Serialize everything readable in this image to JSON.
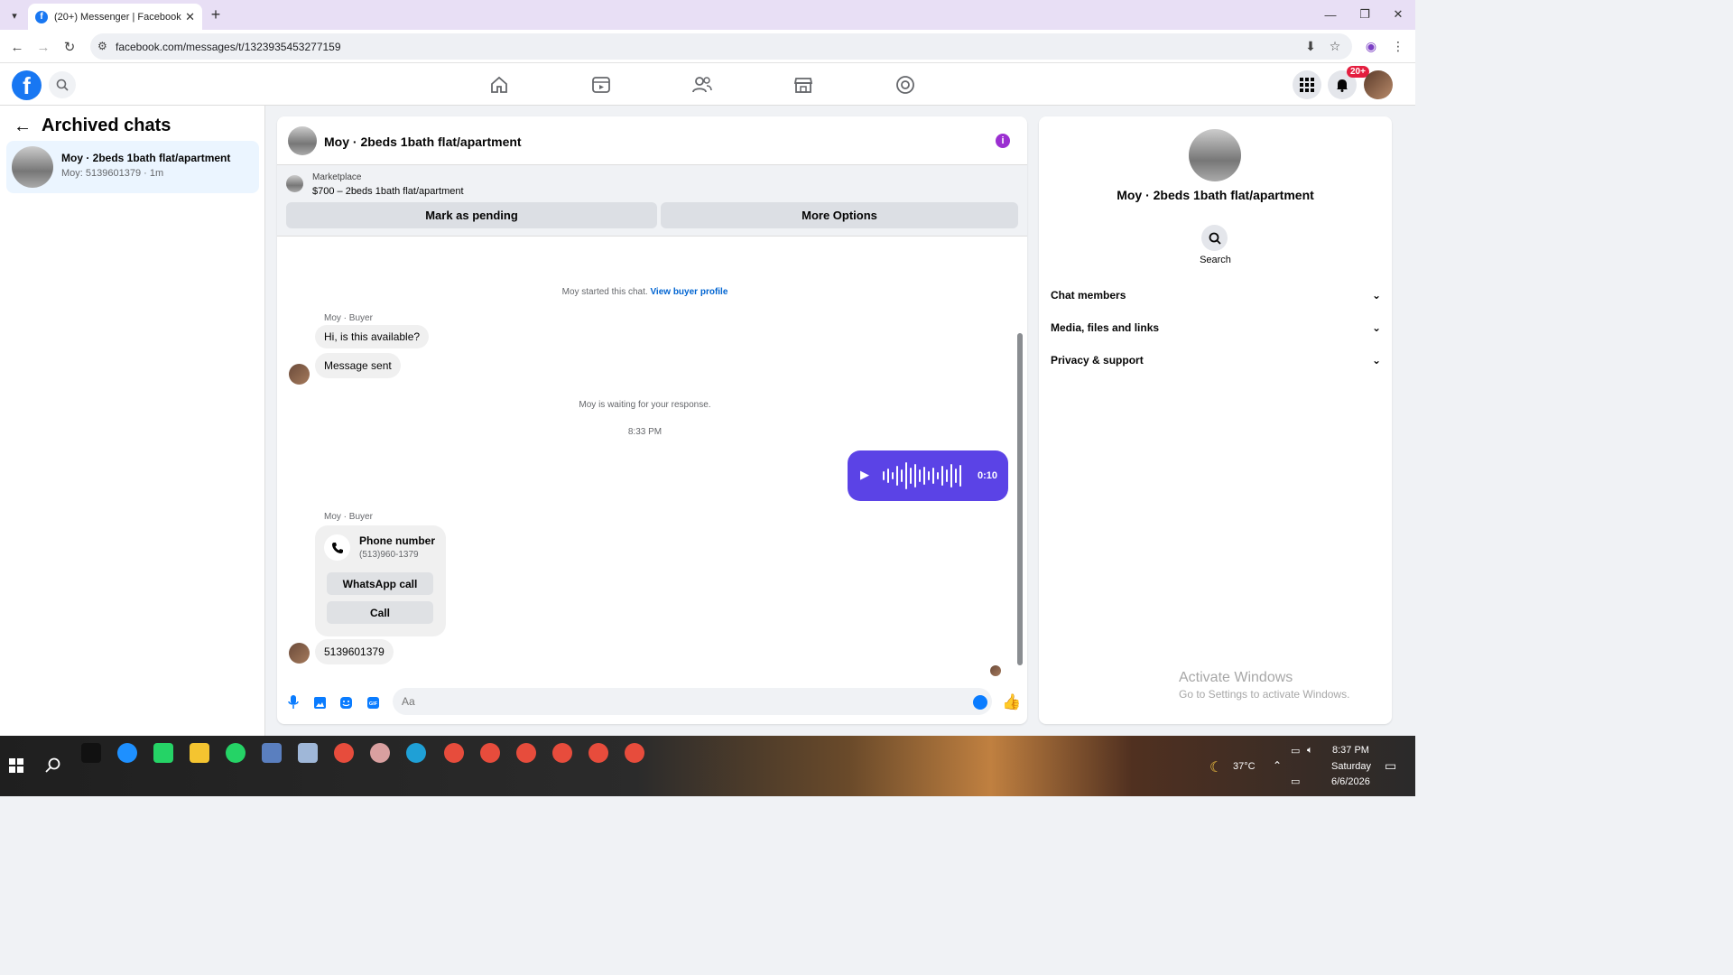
{
  "browser": {
    "tab_title": "(20+) Messenger | Facebook",
    "tab_close": "✕",
    "new_tab": "+",
    "url": "facebook.com/messages/t/1323935453277159",
    "win_min": "—",
    "win_restore": "❐",
    "win_close": "✕"
  },
  "fb_header": {
    "logo": "f",
    "notification_badge": "20+"
  },
  "left_pane": {
    "title": "Archived chats",
    "back_arrow": "←",
    "chats": [
      {
        "name": "Moy · 2beds 1bath flat/apartment",
        "subtitle": "Moy: 5139601379 · 1m"
      }
    ]
  },
  "conversation": {
    "header_name": "Moy · 2beds 1bath flat/apartment",
    "info_icon": "i",
    "marketplace_label": "Marketplace",
    "marketplace_item": "$700 – 2beds 1bath flat/apartment",
    "mark_pending_label": "Mark as pending",
    "more_options_label": "More Options",
    "started_text": "Moy started this chat.",
    "view_buyer_profile": "View buyer profile",
    "sender_label_1": "Moy · Buyer",
    "msg_1": "Hi, is this available?",
    "msg_2": "Message sent",
    "waiting_text": "Moy is waiting for your response.",
    "time_stamp": "8:33 PM",
    "voice_duration": "0:10",
    "play_icon": "▶",
    "sender_label_2": "Moy · Buyer",
    "phone_card_title": "Phone number",
    "phone_card_number": "(513)960-1379",
    "whatsapp_call_label": "WhatsApp call",
    "call_label": "Call",
    "msg_3": "5139601379",
    "composer_placeholder": "Aa",
    "like_icon": "👍"
  },
  "right_pane": {
    "name": "Moy · 2beds 1bath flat/apartment",
    "search_label": "Search",
    "sections": [
      {
        "label": "Chat members",
        "chevron": "⌄"
      },
      {
        "label": "Media, files and links",
        "chevron": "⌄"
      },
      {
        "label": "Privacy & support",
        "chevron": "⌄"
      }
    ]
  },
  "watermark": {
    "line1": "Activate Windows",
    "line2": "Go to Settings to activate Windows."
  },
  "taskbar": {
    "temperature": "37°C",
    "time": "8:37 PM",
    "day": "Saturday",
    "date": "6/6/2026"
  },
  "colors": {
    "facebook_blue": "#1877f2",
    "voice_bubble": "#5b43e6",
    "link_blue": "#0064d1",
    "badge_red": "#e41e3f",
    "info_purple": "#9b2fd1"
  }
}
